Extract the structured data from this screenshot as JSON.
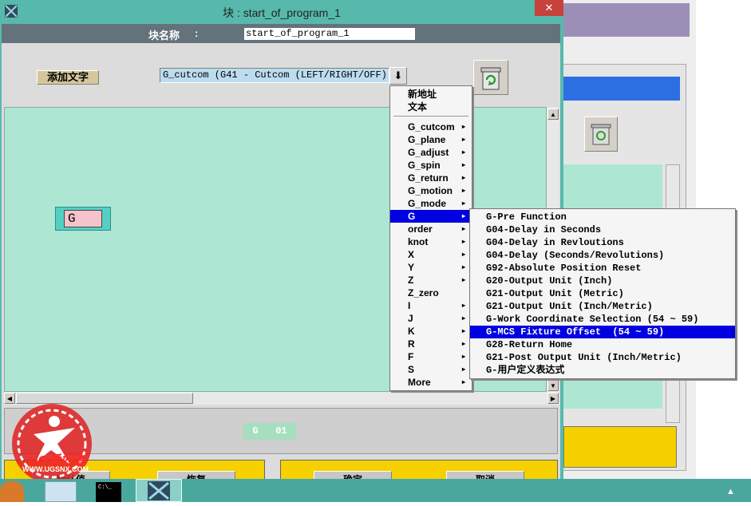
{
  "window": {
    "title": "块 : start_of_program_1",
    "close_glyph": "✕"
  },
  "block_name": {
    "label": "块名称",
    "colon": ":",
    "value": "start_of_program_1"
  },
  "add_text_button": "添加文字",
  "dropdown": {
    "selected": "G_cutcom (G41 - Cutcom (LEFT/RIGHT/OFF))",
    "arrow": "⬇"
  },
  "word_chip": {
    "text": "G"
  },
  "status_chip": {
    "text": "G   01"
  },
  "menu": {
    "top_items": [
      {
        "label": "新地址"
      },
      {
        "label": "文本"
      }
    ],
    "items": [
      {
        "label": "G_cutcom",
        "arrow": "▸"
      },
      {
        "label": "G_plane",
        "arrow": "▸"
      },
      {
        "label": "G_adjust",
        "arrow": "▸"
      },
      {
        "label": "G_spin",
        "arrow": "▸"
      },
      {
        "label": "G_return",
        "arrow": "▸"
      },
      {
        "label": "G_motion",
        "arrow": "▸"
      },
      {
        "label": "G_mode",
        "arrow": "▸"
      },
      {
        "label": "G",
        "arrow": "▸"
      },
      {
        "label": "order",
        "arrow": "▸"
      },
      {
        "label": "knot",
        "arrow": "▸"
      },
      {
        "label": "X",
        "arrow": "▸"
      },
      {
        "label": "Y",
        "arrow": "▸"
      },
      {
        "label": "Z",
        "arrow": "▸"
      },
      {
        "label": "Z_zero",
        "arrow": ""
      },
      {
        "label": "I",
        "arrow": "▸"
      },
      {
        "label": "J",
        "arrow": "▸"
      },
      {
        "label": "K",
        "arrow": "▸"
      },
      {
        "label": "R",
        "arrow": "▸"
      },
      {
        "label": "F",
        "arrow": "▸"
      },
      {
        "label": "S",
        "arrow": "▸"
      },
      {
        "label": "More",
        "arrow": "▸"
      }
    ]
  },
  "submenu": {
    "items": [
      {
        "label": "G-Pre Function"
      },
      {
        "label": "G04-Delay in Seconds"
      },
      {
        "label": "G04-Delay in Revloutions"
      },
      {
        "label": "G04-Delay (Seconds/Revolutions)"
      },
      {
        "label": "G92-Absolute Position Reset"
      },
      {
        "label": "G20-Output Unit (Inch)"
      },
      {
        "label": "G21-Output Unit (Metric)"
      },
      {
        "label": "G21-Output Unit (Inch/Metric)"
      },
      {
        "label": "G-Work Coordinate Selection (54 ~ 59)"
      },
      {
        "label": "G-MCS Fixture Offset  (54 ~ 59)"
      },
      {
        "label": "G28-Return Home"
      },
      {
        "label": "G21-Post Output Unit (Inch/Metric)"
      },
      {
        "label": "G-用户定义表达式"
      }
    ]
  },
  "bottom_buttons": {
    "default": "默认值",
    "restore": "恢复",
    "ok": "确定",
    "cancel": "取消"
  },
  "watermark": {
    "brand": "UG爱好者",
    "url": "WWW.UGSNX.COM"
  },
  "taskbar": {
    "cmd_text": "C:\\_"
  },
  "colors": {
    "titlebar": "#57b9ac",
    "close_red": "#c7413d",
    "canvas": "#aee6d4",
    "highlight": "#0000e0",
    "yellow": "#f7d000"
  }
}
